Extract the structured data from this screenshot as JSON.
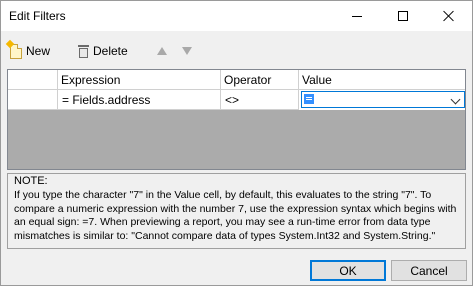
{
  "window": {
    "title": "Edit Filters"
  },
  "toolbar": {
    "new_label": "New",
    "delete_label": "Delete"
  },
  "grid": {
    "columns": [
      "",
      "Expression",
      "Operator",
      "Value"
    ],
    "rows": [
      {
        "expression": "= Fields.address",
        "operator": "<>",
        "value": ""
      }
    ]
  },
  "note": {
    "title": "NOTE:",
    "text": "If you type the character \"7\" in the Value cell, by default, this evaluates to the string \"7\". To compare a numeric expression with the number 7, use the expression syntax which begins with an equal sign: =7. When previewing a report, you may see a run-time error from data type mismatches is similar to: \"Cannot compare data of types System.Int32 and System.String.\""
  },
  "buttons": {
    "ok": "OK",
    "cancel": "Cancel"
  },
  "colors": {
    "accent": "#0078d7",
    "grid_background": "#ababab"
  }
}
